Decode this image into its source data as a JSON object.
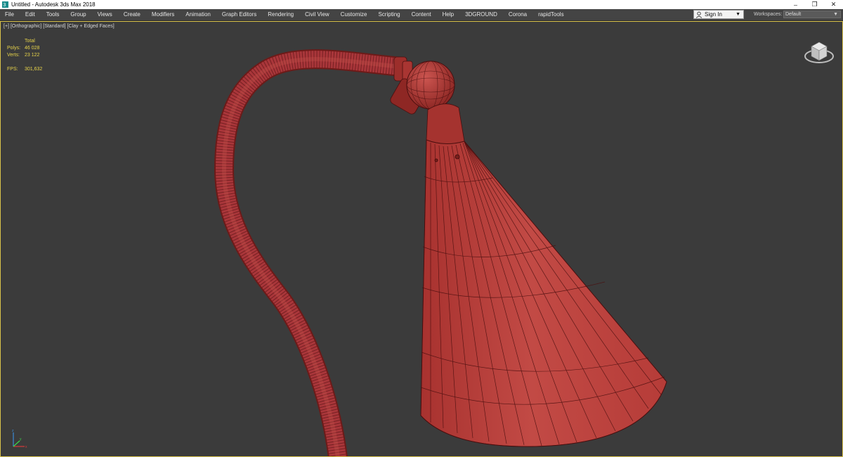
{
  "window": {
    "title": "Untitled - Autodesk 3ds Max 2018",
    "controls": {
      "minimize": "–",
      "restore": "❐",
      "close": "✕"
    }
  },
  "menu": {
    "items": [
      "File",
      "Edit",
      "Tools",
      "Group",
      "Views",
      "Create",
      "Modifiers",
      "Animation",
      "Graph Editors",
      "Rendering",
      "Civil View",
      "Customize",
      "Scripting",
      "Content",
      "Help",
      "3DGROUND",
      "Corona",
      "rapidTools"
    ]
  },
  "account": {
    "signin_label": "Sign In"
  },
  "workspaces": {
    "label": "Workspaces:",
    "value": "Default"
  },
  "viewport": {
    "label_plus": "[+]",
    "label_view": "[Orthographic]",
    "label_shading": "[Standard]",
    "label_mode": "[Clay + Edged Faces]",
    "stats": {
      "header": "Total",
      "polys_label": "Polys:",
      "polys_value": "46 028",
      "verts_label": "Verts:",
      "verts_value": "23 122",
      "fps_label": "FPS:",
      "fps_value": "301,632"
    }
  },
  "colors": {
    "background": "#3b3b3b",
    "viewport_border": "#d9c24a",
    "stats_text": "#e6d24a",
    "model_clay": "#b8403d",
    "wire_edges": "#4a0f0f"
  }
}
